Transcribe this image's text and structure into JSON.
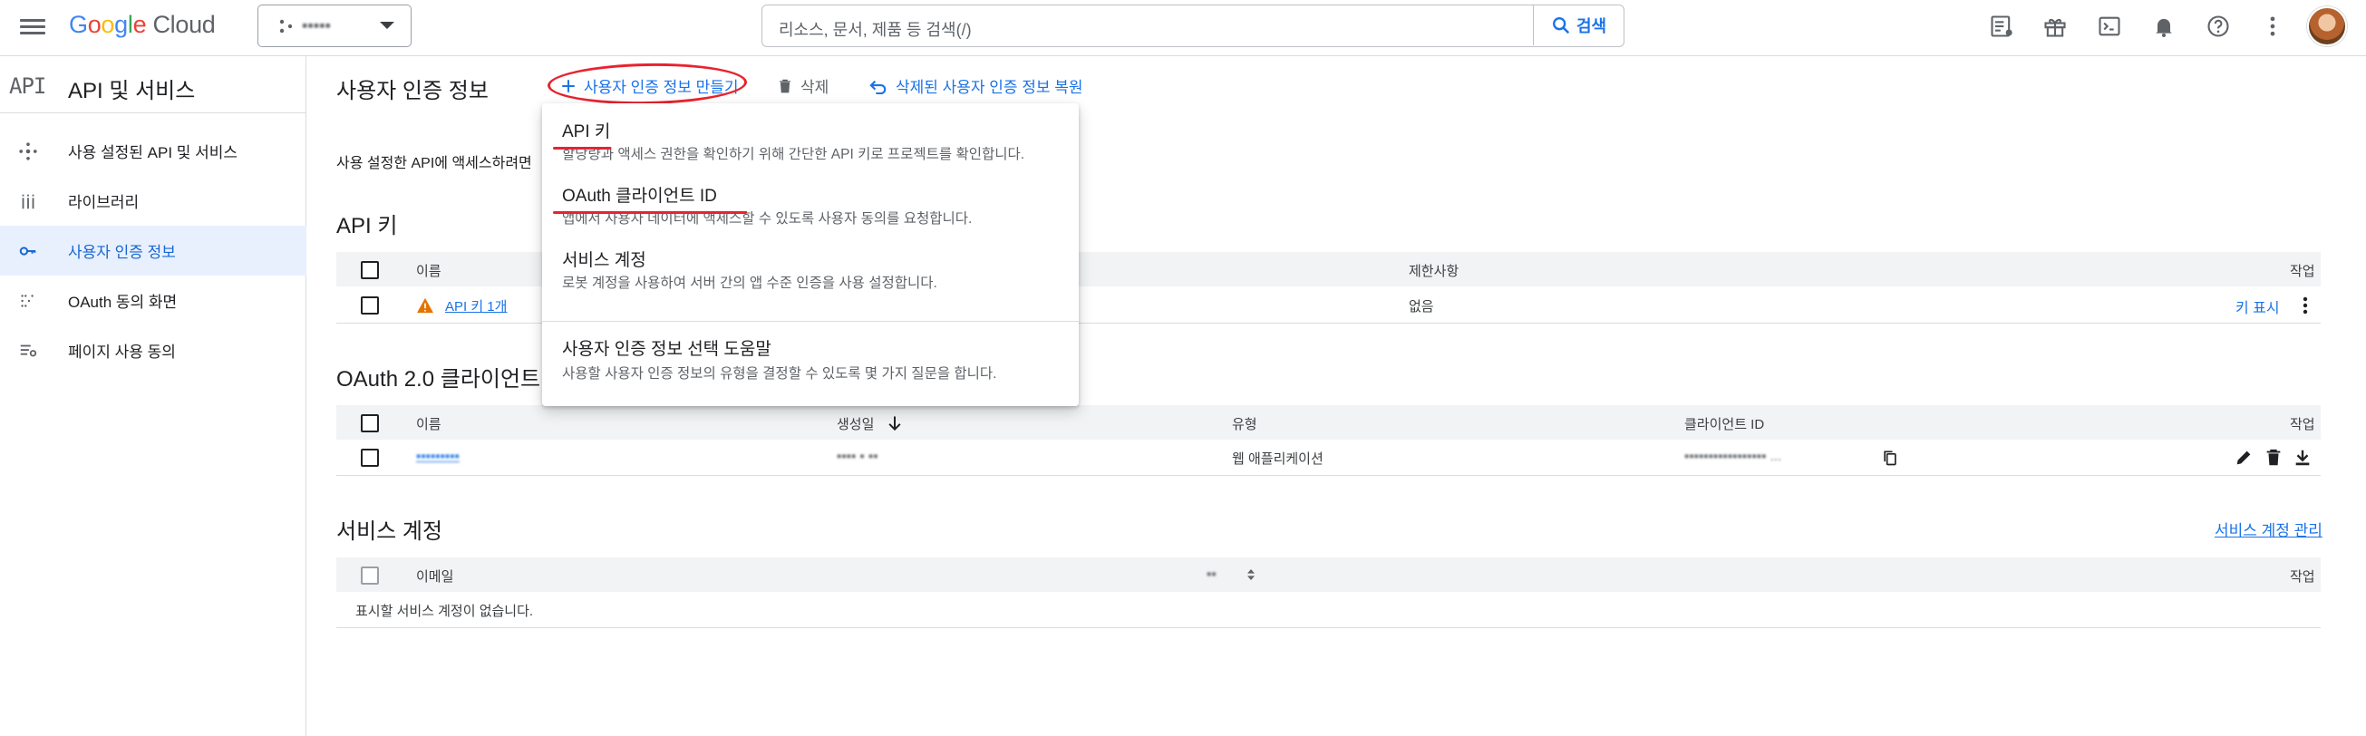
{
  "topbar": {
    "logo_text": "Google Cloud",
    "project_name": "▪▪▪▪▪",
    "search_placeholder": "리소스, 문서, 제품 등 검색(/)",
    "search_button": "검색",
    "icons": [
      "menu-icon",
      "release-notes-icon",
      "gift-icon",
      "terminal-icon",
      "bell-icon",
      "help-icon",
      "more-vert-icon",
      "avatar"
    ]
  },
  "sidebar": {
    "logo": "API",
    "title": "API 및 서비스",
    "items": [
      {
        "label": "사용 설정된 API 및 서비스",
        "icon": "hub-icon"
      },
      {
        "label": "라이브러리",
        "icon": "library-icon"
      },
      {
        "label": "사용자 인증 정보",
        "icon": "key-icon",
        "active": true
      },
      {
        "label": "OAuth 동의 화면",
        "icon": "consent-icon"
      },
      {
        "label": "페이지 사용 동의",
        "icon": "settings-list-icon"
      }
    ]
  },
  "main": {
    "title": "사용자 인증 정보",
    "actions": {
      "create": "사용자 인증 정보 만들기",
      "delete": "삭제",
      "restore": "삭제된 사용자 인증 정보 복원"
    },
    "intro": "사용 설정한 API에 액세스하려면"
  },
  "menu": {
    "items": [
      {
        "title": "API 키",
        "desc": "할당량과 액세스 권한을 확인하기 위해 간단한 API 키로 프로젝트를 확인합니다."
      },
      {
        "title": "OAuth 클라이언트 ID",
        "desc": "앱에서 사용자 데이터에 액세스할 수 있도록 사용자 동의를 요청합니다."
      },
      {
        "title": "서비스 계정",
        "desc": "로봇 계정을 사용하여 서버 간의 앱 수준 인증을 사용 설정합니다."
      },
      {
        "title": "사용자 인증 정보 선택 도움말",
        "desc": "사용할 사용자 인증 정보의 유형을 결정할 수 있도록 몇 가지 질문을 합니다."
      }
    ]
  },
  "api_keys": {
    "title": "API 키",
    "headers": {
      "name": "이름",
      "restrictions": "제한사항",
      "actions": "작업"
    },
    "row": {
      "name": "API 키 1개",
      "restrictions": "없음",
      "show_key": "키 표시"
    }
  },
  "oauth": {
    "title": "OAuth 2.0 클라이언트",
    "headers": {
      "name": "이름",
      "created": "생성일",
      "type": "유형",
      "client_id": "클라이언트 ID",
      "actions": "작업"
    },
    "row": {
      "name": "▪▪▪▪▪▪▪▪▪",
      "created": "▪▪▪▪ ▪ ▪▪",
      "type": "웹 애플리케이션",
      "client_id": "▪▪▪▪▪▪▪▪▪▪▪▪▪▪▪▪▪ ..."
    }
  },
  "service_accounts": {
    "title": "서비스 계정",
    "manage_link": "서비스 계정 관리",
    "headers": {
      "email": "이메일",
      "name": "▪▪",
      "actions": "작업"
    },
    "empty": "표시할 서비스 계정이 없습니다."
  },
  "colors": {
    "accent": "#1a73e8",
    "annotation": "#e8232f",
    "active_bg": "#e8f0fe",
    "warning": "#e37400"
  }
}
